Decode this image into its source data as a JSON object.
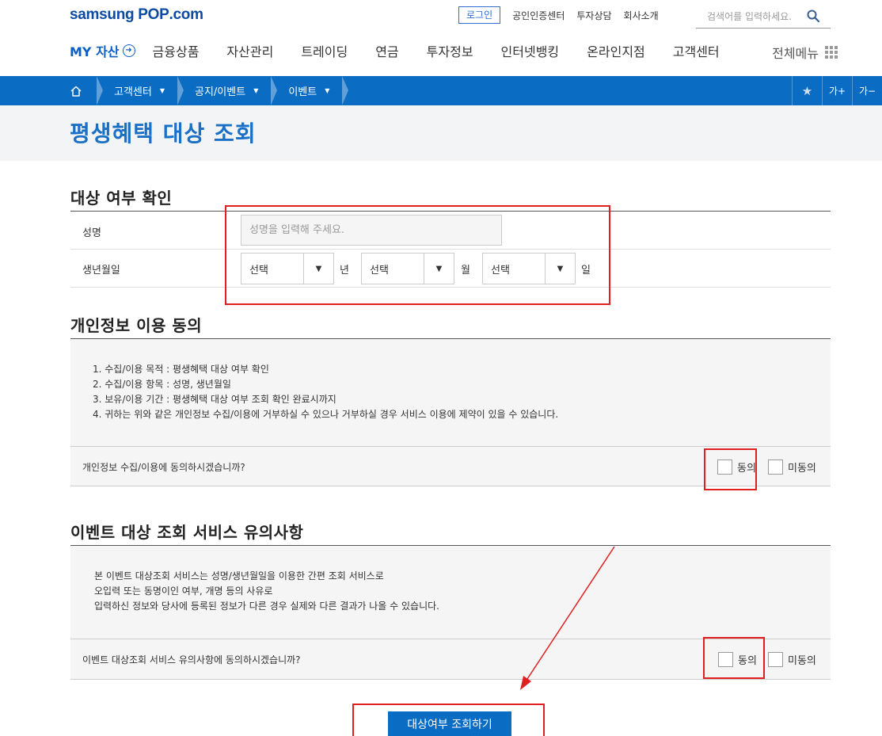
{
  "header": {
    "logo": {
      "left": "samsung ",
      "pop": "POP",
      "right": ".com"
    },
    "login_label": "로그인",
    "util_links": [
      "공인인증센터",
      "투자상담",
      "회사소개"
    ],
    "search_placeholder": "검색어를 입력하세요."
  },
  "gnb": {
    "my_label": "MY 자산",
    "menus": [
      "금융상품",
      "자산관리",
      "트레이딩",
      "연금",
      "투자정보",
      "인터넷뱅킹",
      "온라인지점",
      "고객센터"
    ],
    "all_menu": "전체메뉴"
  },
  "breadcrumb": {
    "items": [
      "고객센터",
      "공지/이벤트",
      "이벤트"
    ],
    "font_up": "가+",
    "font_down": "가−"
  },
  "page": {
    "title": "평생혜택 대상 조회"
  },
  "target_check": {
    "title": "대상 여부 확인",
    "name_label": "성명",
    "name_placeholder": "성명을 입력해 주세요.",
    "birth_label": "생년월일",
    "year_value": "선택",
    "year_unit": "년",
    "month_value": "선택",
    "month_unit": "월",
    "day_value": "선택",
    "day_unit": "일"
  },
  "privacy": {
    "title": "개인정보 이용 동의",
    "lines": [
      "1. 수집/이용 목적 : 평생혜택 대상 여부 확인",
      "2. 수집/이용 항목 : 성명, 생년월일",
      "3. 보유/이용 기간 : 평생혜택 대상 여부 조회 확인 완료시까지",
      "4. 귀하는 위와 같은 개인정보 수집/이용에 거부하실 수 있으나 거부하실 경우 서비스 이용에 제약이 있을 수 있습니다."
    ],
    "question": "개인정보 수집/이용에 동의하시겠습니까?",
    "agree": "동의",
    "disagree": "미동의"
  },
  "notice": {
    "title": "이벤트 대상 조회 서비스 유의사항",
    "lines": [
      "본 이벤트 대상조회 서비스는 성명/생년월일을 이용한 간편 조회 서비스로",
      "오입력 또는 동명이인 여부, 개명 등의 사유로",
      "입력하신 정보와 당사에 등록된 정보가 다른 경우 실제와 다른 결과가 나올 수 있습니다."
    ],
    "question": "이벤트 대상조회 서비스 유의사항에 동의하시겠습니까?",
    "agree": "동의",
    "disagree": "미동의"
  },
  "submit_label": "대상여부 조회하기",
  "colors": {
    "brand_blue": "#0b6cc4",
    "title_blue": "#1a6fc7",
    "annotation_red": "#e02020"
  }
}
